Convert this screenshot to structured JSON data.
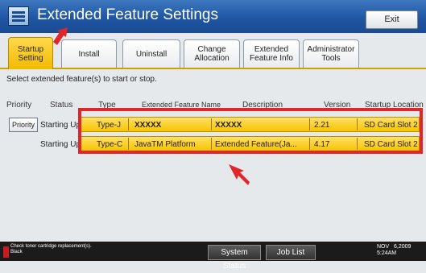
{
  "header": {
    "title": "Extended Feature Settings",
    "exit_label": "Exit"
  },
  "tabs": [
    {
      "label": "Startup Setting",
      "active": true
    },
    {
      "label": "Install",
      "active": false
    },
    {
      "label": "Uninstall",
      "active": false
    },
    {
      "label": "Change Allocation",
      "active": false
    },
    {
      "label": "Extended Feature Info",
      "active": false
    },
    {
      "label": "Administrator Tools",
      "active": false
    }
  ],
  "instruction": "Select extended feature(s) to start or stop.",
  "columns": {
    "priority": "Priority",
    "status": "Status",
    "type": "Type",
    "name": "Extended Feature Name",
    "description": "Description",
    "version": "Version",
    "location": "Startup Location"
  },
  "priority_button": "Priority",
  "rows": [
    {
      "status": "Starting Up",
      "type": "Type-J",
      "name": "XXXXX",
      "description": "XXXXX",
      "version": "2.21",
      "location": "SD Card Slot 2"
    },
    {
      "status": "Starting Up",
      "type": "Type-C",
      "name": "JavaTM Platform",
      "description": "Extended Feature(Ja...",
      "version": "4.17",
      "location": "SD Card Slot 2"
    }
  ],
  "footer": {
    "message": "Check toner cartridge replacement(s).",
    "toner_color": "Black",
    "system_status_label": "System Status",
    "job_list_label": "Job List",
    "date_line1": "NOV   6,2009",
    "date_line2": "5:24AM"
  },
  "colors": {
    "header": "#1f56a3",
    "active_tab": "#f6c400",
    "row_highlight": "#f6c400",
    "annotation": "#e0262b"
  }
}
